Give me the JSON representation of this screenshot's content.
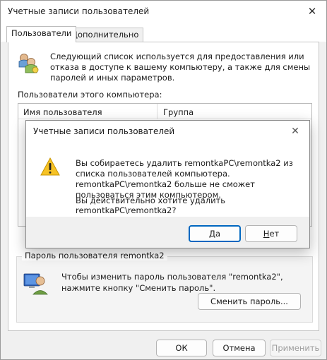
{
  "window": {
    "title": "Учетные записи пользователей",
    "close_glyph": "✕"
  },
  "tabs": [
    {
      "label": "Пользователи",
      "active": true
    },
    {
      "label": "Дополнительно",
      "active": false
    }
  ],
  "main": {
    "intro_text": "Следующий список используется для предоставления или отказа в доступе к вашему компьютеру, а также для смены паролей и иных параметров.",
    "list_caption": "Пользователи этого компьютера:",
    "columns": [
      "Имя пользователя",
      "Группа"
    ]
  },
  "password_group": {
    "legend": "Пароль пользователя remontka2",
    "text": "Чтобы изменить пароль пользователя \"remontka2\", нажмите кнопку \"Сменить пароль\".",
    "change_button": "Сменить пароль..."
  },
  "footer": {
    "ok": "ОК",
    "cancel": "Отмена",
    "apply": "Применить"
  },
  "dialog": {
    "title": "Учетные записи пользователей",
    "close_glyph": "✕",
    "message": "Вы собираетесь удалить remontkaPC\\remontka2 из списка пользователей компьютера. remontkaPC\\remontka2 больше не сможет пользоваться этим компьютером.",
    "question": "Вы действительно хотите удалить remontkaPC\\remontka2?",
    "yes_label_first": "Д",
    "yes_label_rest": "а",
    "no_label_first": "Н",
    "no_label_rest": "ет"
  },
  "colors": {
    "accent": "#0067c0",
    "warning_fill": "#f6c225"
  },
  "icons": {
    "users": "users-icon",
    "user_password": "user-password-icon",
    "warning": "warning-icon"
  }
}
